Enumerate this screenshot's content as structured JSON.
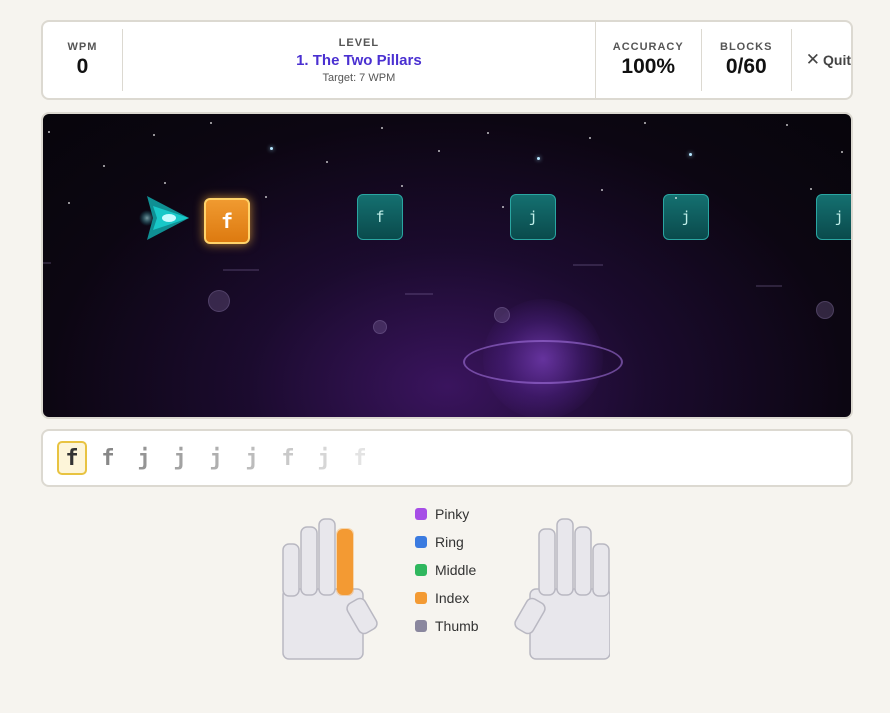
{
  "hud": {
    "wpm_label": "WPM",
    "wpm_value": "0",
    "level_label": "LEVEL",
    "level_name": "1. The Two Pillars",
    "level_target": "Target: 7 WPM",
    "accuracy_label": "ACCURACY",
    "accuracy_value": "100%",
    "blocks_label": "BLOCKS",
    "blocks_value": "0/60",
    "quit_label": "Quit",
    "quit_icon": "close-icon"
  },
  "game": {
    "blocks": [
      {
        "char": "f",
        "state": "active"
      },
      {
        "char": "f",
        "state": "pending"
      },
      {
        "char": "j",
        "state": "pending"
      },
      {
        "char": "j",
        "state": "pending"
      },
      {
        "char": "j",
        "state": "pending"
      }
    ]
  },
  "sequence": {
    "letters": [
      "f",
      "f",
      "j",
      "j",
      "j",
      "j",
      "f",
      "j",
      "f"
    ],
    "current_index": 0
  },
  "legend": {
    "items": [
      {
        "label": "Pinky",
        "color": "#a64ee6"
      },
      {
        "label": "Ring",
        "color": "#3b7be0"
      },
      {
        "label": "Middle",
        "color": "#2fb75e"
      },
      {
        "label": "Index",
        "color": "#f39a33"
      },
      {
        "label": "Thumb",
        "color": "#8a879e"
      }
    ]
  },
  "colors": {
    "accent": "#4a30d1",
    "active_block": "#f09a30",
    "pending_block": "#147070",
    "highlight_finger": "#f39a33"
  }
}
